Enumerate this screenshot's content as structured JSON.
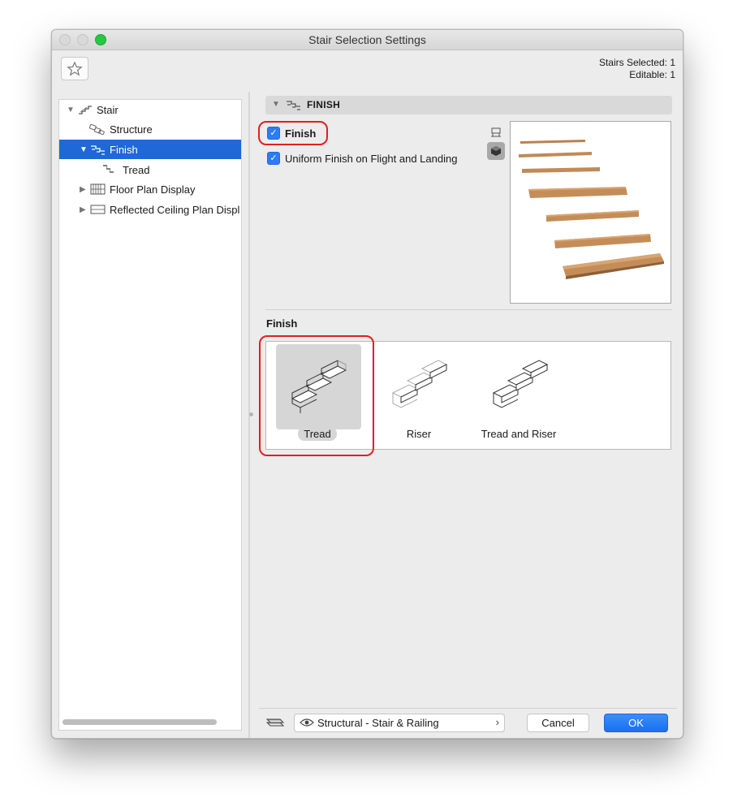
{
  "window": {
    "title": "Stair Selection Settings"
  },
  "status": {
    "line1": "Stairs Selected: 1",
    "line2": "Editable: 1"
  },
  "tree": {
    "items": [
      {
        "label": "Stair",
        "icon": "stair-icon",
        "expanded": true
      },
      {
        "label": "Structure",
        "icon": "structure-icon"
      },
      {
        "label": "Finish",
        "icon": "finish-icon",
        "expanded": true,
        "selected": true
      },
      {
        "label": "Tread",
        "icon": "tread-icon"
      },
      {
        "label": "Floor Plan Display",
        "icon": "floor-plan-icon",
        "expanded": false
      },
      {
        "label": "Reflected Ceiling Plan Displ",
        "icon": "ceiling-plan-icon",
        "expanded": false
      }
    ]
  },
  "panel": {
    "header": "FINISH",
    "finish_checkbox": {
      "label": "Finish",
      "checked": true
    },
    "uniform_checkbox": {
      "label": "Uniform Finish on Flight and Landing",
      "checked": true
    },
    "section_title": "Finish",
    "options": [
      {
        "label": "Tread",
        "selected": true
      },
      {
        "label": "Riser",
        "selected": false
      },
      {
        "label": "Tread and Riser",
        "selected": false
      }
    ]
  },
  "footer": {
    "favorite_set": "Structural - Stair & Railing",
    "cancel_label": "Cancel",
    "ok_label": "OK"
  },
  "colors": {
    "selection": "#1e68d8",
    "highlight": "#e02020",
    "wood": "#c08a56",
    "ok_button": "#2a7ff5"
  }
}
